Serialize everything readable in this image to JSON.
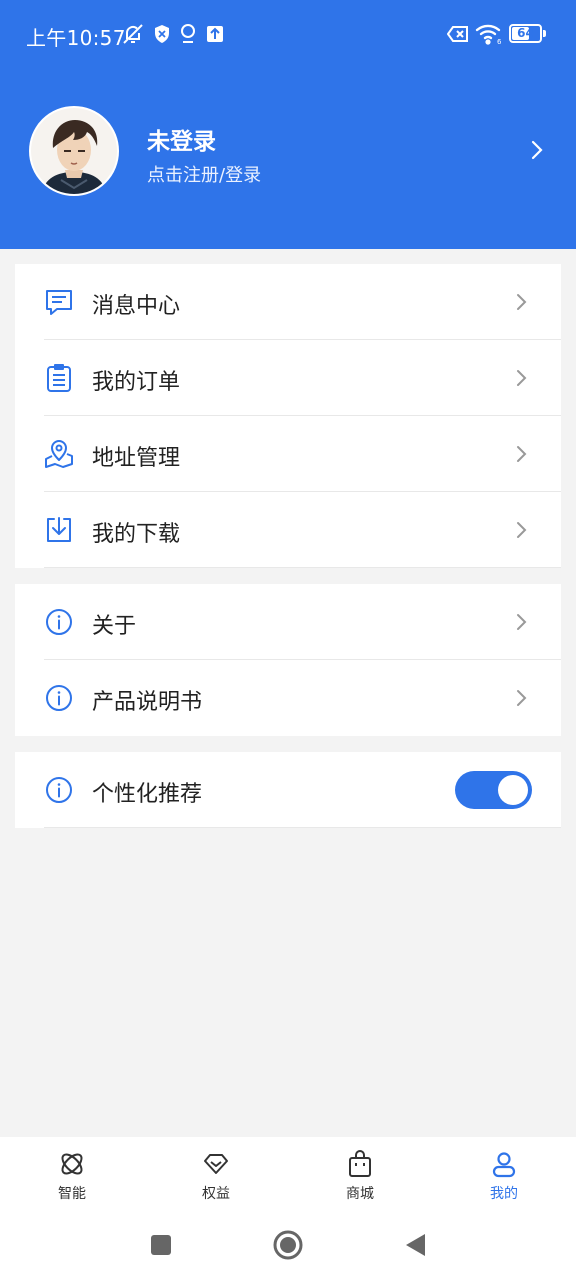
{
  "status_bar": {
    "time": "上午10:57",
    "battery": "64",
    "battery_percent": 64,
    "icons": [
      "bell-off-icon",
      "shield-icon",
      "location-icon",
      "upload-icon",
      "sim-off-icon",
      "wifi-icon",
      "battery-icon"
    ]
  },
  "profile": {
    "name": "未登录",
    "subtitle": "点击注册/登录",
    "avatar": "avatar"
  },
  "menu_group_1": [
    {
      "label": "消息中心",
      "icon": "message-icon"
    },
    {
      "label": "我的订单",
      "icon": "clipboard-icon"
    },
    {
      "label": "地址管理",
      "icon": "map-pin-icon"
    },
    {
      "label": "我的下载",
      "icon": "download-icon"
    }
  ],
  "menu_group_2": [
    {
      "label": "关于",
      "icon": "info-icon"
    },
    {
      "label": "产品说明书",
      "icon": "info-icon"
    }
  ],
  "menu_group_3": [
    {
      "label": "个性化推荐",
      "icon": "info-icon",
      "toggle_on": true
    }
  ],
  "tabs": [
    {
      "label": "智能",
      "icon": "atom-icon",
      "active": false
    },
    {
      "label": "权益",
      "icon": "gift-icon",
      "active": false
    },
    {
      "label": "商城",
      "icon": "shopping-bag-icon",
      "active": false
    },
    {
      "label": "我的",
      "icon": "user-icon",
      "active": true
    }
  ],
  "colors": {
    "primary": "#2f74e9",
    "background": "#f3f3f3",
    "card": "#ffffff"
  }
}
